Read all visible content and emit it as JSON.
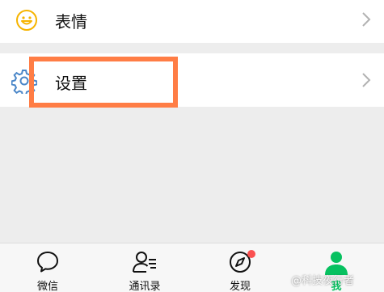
{
  "menu": {
    "emoji": {
      "label": "表情",
      "icon": "emoji-icon"
    },
    "settings": {
      "label": "设置",
      "icon": "gear-icon"
    }
  },
  "highlight": {
    "color": "#ff7d45"
  },
  "tabbar": {
    "tabs": [
      {
        "label": "微信",
        "icon": "chat-bubble-icon",
        "active": false
      },
      {
        "label": "通讯录",
        "icon": "contacts-icon",
        "active": false
      },
      {
        "label": "发现",
        "icon": "compass-icon",
        "active": false,
        "badge": "red-dot"
      },
      {
        "label": "我",
        "icon": "person-icon",
        "active": true
      }
    ],
    "active_color": "#07c160"
  },
  "watermark": {
    "text": "@科技夜行者"
  }
}
